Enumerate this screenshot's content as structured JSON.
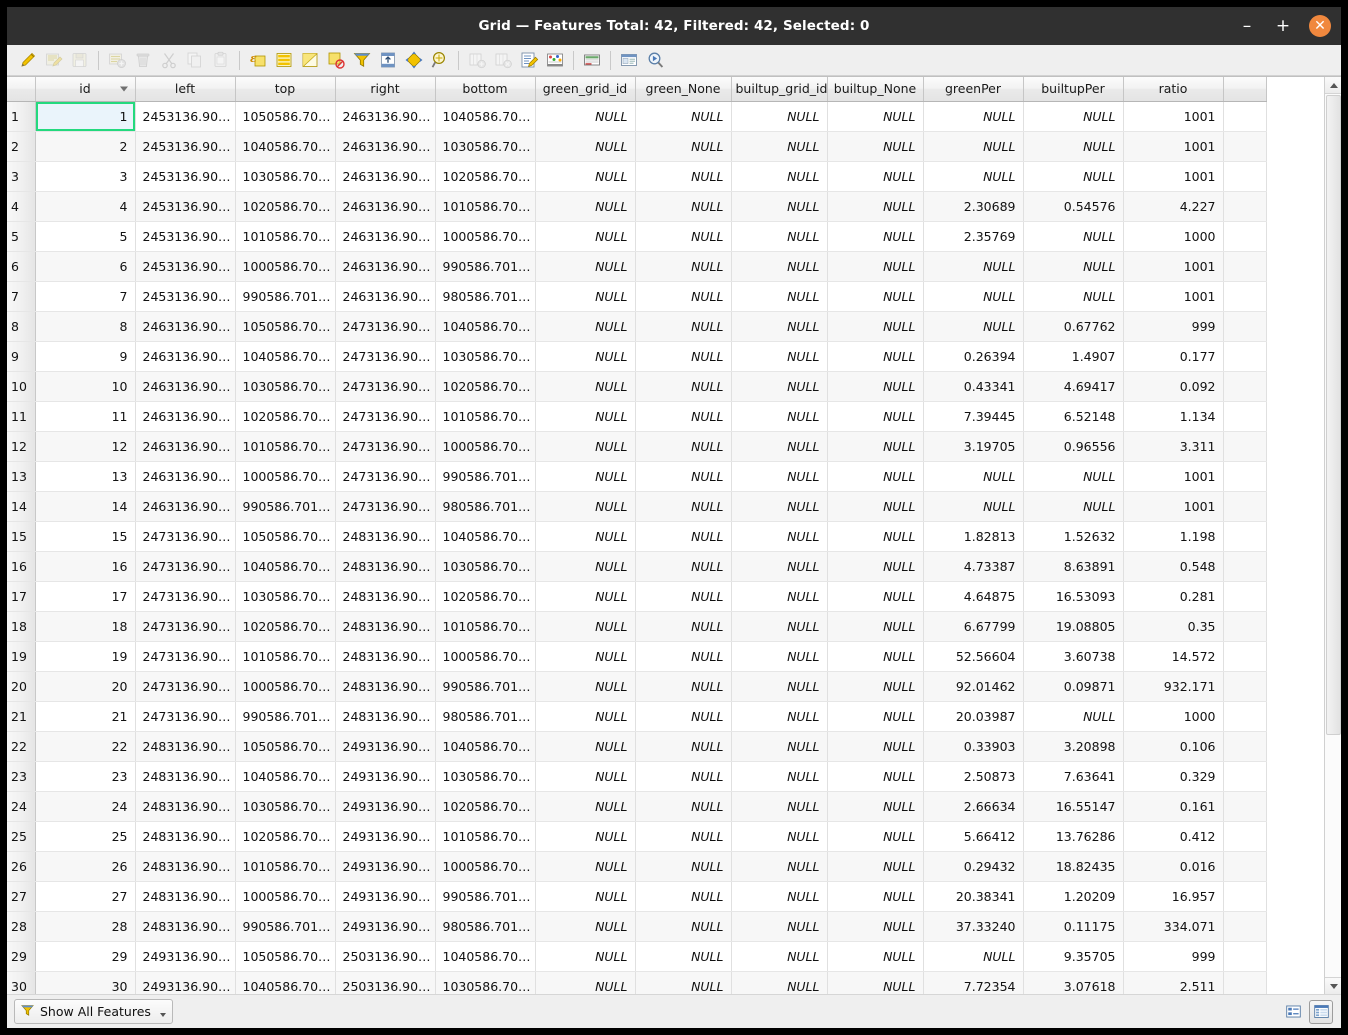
{
  "window": {
    "title": "Grid — Features Total: 42, Filtered: 42, Selected: 0",
    "minimize_label": "–",
    "maximize_label": "+",
    "close_label": "✕"
  },
  "toolbar": {
    "items": [
      {
        "name": "toggle-editing-icon",
        "tip": "Toggle editing mode",
        "enabled": true
      },
      {
        "name": "save-edits-icon",
        "tip": "Save edits",
        "enabled": false
      },
      {
        "name": "reload-table-icon",
        "tip": "Reload the table",
        "enabled": false
      },
      {
        "name": "separator",
        "tip": "",
        "enabled": false
      },
      {
        "name": "add-feature-icon",
        "tip": "Add feature",
        "enabled": false
      },
      {
        "name": "delete-selected-icon",
        "tip": "Delete selected features",
        "enabled": false
      },
      {
        "name": "cut-features-icon",
        "tip": "Cut selected features",
        "enabled": false
      },
      {
        "name": "copy-features-icon",
        "tip": "Copy selected features",
        "enabled": false
      },
      {
        "name": "paste-features-icon",
        "tip": "Paste features",
        "enabled": false
      },
      {
        "name": "separator",
        "tip": "",
        "enabled": false
      },
      {
        "name": "select-by-expression-icon",
        "tip": "Select features using an expression",
        "enabled": true
      },
      {
        "name": "select-all-icon",
        "tip": "Select all features",
        "enabled": true
      },
      {
        "name": "invert-selection-icon",
        "tip": "Invert selection",
        "enabled": true
      },
      {
        "name": "deselect-all-icon",
        "tip": "Deselect all features",
        "enabled": true
      },
      {
        "name": "filter-selection-icon",
        "tip": "Filter / select features",
        "enabled": true
      },
      {
        "name": "move-selection-to-top-icon",
        "tip": "Move selection to top",
        "enabled": true
      },
      {
        "name": "pan-map-to-selection-icon",
        "tip": "Pan map to selected rows",
        "enabled": true
      },
      {
        "name": "zoom-map-to-selection-icon",
        "tip": "Zoom map to selected rows",
        "enabled": true
      },
      {
        "name": "separator",
        "tip": "",
        "enabled": false
      },
      {
        "name": "new-field-icon",
        "tip": "New field",
        "enabled": false
      },
      {
        "name": "delete-field-icon",
        "tip": "Delete field",
        "enabled": false
      },
      {
        "name": "open-field-calculator-icon",
        "tip": "Open field calculator",
        "enabled": true
      },
      {
        "name": "conditional-formatting-icon",
        "tip": "Conditional formatting",
        "enabled": true
      },
      {
        "name": "separator",
        "tip": "",
        "enabled": false
      },
      {
        "name": "organize-columns-icon",
        "tip": "Organize columns",
        "enabled": true
      },
      {
        "name": "separator",
        "tip": "",
        "enabled": false
      },
      {
        "name": "actions-icon",
        "tip": "Actions",
        "enabled": true
      },
      {
        "name": "form-view-search-icon",
        "tip": "Zoom to features",
        "enabled": true
      }
    ]
  },
  "table": {
    "sorted_column": "id",
    "sort_direction": "descending-arrow",
    "selected_cell": {
      "row": 1,
      "column": "id"
    },
    "null_label": "NULL",
    "columns": [
      {
        "key": "id",
        "label": "id"
      },
      {
        "key": "left",
        "label": "left"
      },
      {
        "key": "top",
        "label": "top"
      },
      {
        "key": "right",
        "label": "right"
      },
      {
        "key": "bottom",
        "label": "bottom"
      },
      {
        "key": "green_grid_id",
        "label": "green_grid_id"
      },
      {
        "key": "green_None",
        "label": "green_None"
      },
      {
        "key": "builtup_grid_id",
        "label": "builtup_grid_id"
      },
      {
        "key": "builtup_None",
        "label": "builtup_None"
      },
      {
        "key": "greenPer",
        "label": "greenPer"
      },
      {
        "key": "builtupPer",
        "label": "builtupPer"
      },
      {
        "key": "ratio",
        "label": "ratio"
      }
    ],
    "rows": [
      {
        "n": "1",
        "id": "1",
        "left": "2453136.90…",
        "top": "1050586.70…",
        "right": "2463136.90…",
        "bottom": "1040586.70…",
        "green_grid_id": "NULL",
        "green_None": "NULL",
        "builtup_grid_id": "NULL",
        "builtup_None": "NULL",
        "greenPer": "NULL",
        "builtupPer": "NULL",
        "ratio": "1001"
      },
      {
        "n": "2",
        "id": "2",
        "left": "2453136.90…",
        "top": "1040586.70…",
        "right": "2463136.90…",
        "bottom": "1030586.70…",
        "green_grid_id": "NULL",
        "green_None": "NULL",
        "builtup_grid_id": "NULL",
        "builtup_None": "NULL",
        "greenPer": "NULL",
        "builtupPer": "NULL",
        "ratio": "1001"
      },
      {
        "n": "3",
        "id": "3",
        "left": "2453136.90…",
        "top": "1030586.70…",
        "right": "2463136.90…",
        "bottom": "1020586.70…",
        "green_grid_id": "NULL",
        "green_None": "NULL",
        "builtup_grid_id": "NULL",
        "builtup_None": "NULL",
        "greenPer": "NULL",
        "builtupPer": "NULL",
        "ratio": "1001"
      },
      {
        "n": "4",
        "id": "4",
        "left": "2453136.90…",
        "top": "1020586.70…",
        "right": "2463136.90…",
        "bottom": "1010586.70…",
        "green_grid_id": "NULL",
        "green_None": "NULL",
        "builtup_grid_id": "NULL",
        "builtup_None": "NULL",
        "greenPer": "2.30689",
        "builtupPer": "0.54576",
        "ratio": "4.227"
      },
      {
        "n": "5",
        "id": "5",
        "left": "2453136.90…",
        "top": "1010586.70…",
        "right": "2463136.90…",
        "bottom": "1000586.70…",
        "green_grid_id": "NULL",
        "green_None": "NULL",
        "builtup_grid_id": "NULL",
        "builtup_None": "NULL",
        "greenPer": "2.35769",
        "builtupPer": "NULL",
        "ratio": "1000"
      },
      {
        "n": "6",
        "id": "6",
        "left": "2453136.90…",
        "top": "1000586.70…",
        "right": "2463136.90…",
        "bottom": "990586.701…",
        "green_grid_id": "NULL",
        "green_None": "NULL",
        "builtup_grid_id": "NULL",
        "builtup_None": "NULL",
        "greenPer": "NULL",
        "builtupPer": "NULL",
        "ratio": "1001"
      },
      {
        "n": "7",
        "id": "7",
        "left": "2453136.90…",
        "top": "990586.701…",
        "right": "2463136.90…",
        "bottom": "980586.701…",
        "green_grid_id": "NULL",
        "green_None": "NULL",
        "builtup_grid_id": "NULL",
        "builtup_None": "NULL",
        "greenPer": "NULL",
        "builtupPer": "NULL",
        "ratio": "1001"
      },
      {
        "n": "8",
        "id": "8",
        "left": "2463136.90…",
        "top": "1050586.70…",
        "right": "2473136.90…",
        "bottom": "1040586.70…",
        "green_grid_id": "NULL",
        "green_None": "NULL",
        "builtup_grid_id": "NULL",
        "builtup_None": "NULL",
        "greenPer": "NULL",
        "builtupPer": "0.67762",
        "ratio": "999"
      },
      {
        "n": "9",
        "id": "9",
        "left": "2463136.90…",
        "top": "1040586.70…",
        "right": "2473136.90…",
        "bottom": "1030586.70…",
        "green_grid_id": "NULL",
        "green_None": "NULL",
        "builtup_grid_id": "NULL",
        "builtup_None": "NULL",
        "greenPer": "0.26394",
        "builtupPer": "1.4907",
        "ratio": "0.177"
      },
      {
        "n": "10",
        "id": "10",
        "left": "2463136.90…",
        "top": "1030586.70…",
        "right": "2473136.90…",
        "bottom": "1020586.70…",
        "green_grid_id": "NULL",
        "green_None": "NULL",
        "builtup_grid_id": "NULL",
        "builtup_None": "NULL",
        "greenPer": "0.43341",
        "builtupPer": "4.69417",
        "ratio": "0.092"
      },
      {
        "n": "11",
        "id": "11",
        "left": "2463136.90…",
        "top": "1020586.70…",
        "right": "2473136.90…",
        "bottom": "1010586.70…",
        "green_grid_id": "NULL",
        "green_None": "NULL",
        "builtup_grid_id": "NULL",
        "builtup_None": "NULL",
        "greenPer": "7.39445",
        "builtupPer": "6.52148",
        "ratio": "1.134"
      },
      {
        "n": "12",
        "id": "12",
        "left": "2463136.90…",
        "top": "1010586.70…",
        "right": "2473136.90…",
        "bottom": "1000586.70…",
        "green_grid_id": "NULL",
        "green_None": "NULL",
        "builtup_grid_id": "NULL",
        "builtup_None": "NULL",
        "greenPer": "3.19705",
        "builtupPer": "0.96556",
        "ratio": "3.311"
      },
      {
        "n": "13",
        "id": "13",
        "left": "2463136.90…",
        "top": "1000586.70…",
        "right": "2473136.90…",
        "bottom": "990586.701…",
        "green_grid_id": "NULL",
        "green_None": "NULL",
        "builtup_grid_id": "NULL",
        "builtup_None": "NULL",
        "greenPer": "NULL",
        "builtupPer": "NULL",
        "ratio": "1001"
      },
      {
        "n": "14",
        "id": "14",
        "left": "2463136.90…",
        "top": "990586.701…",
        "right": "2473136.90…",
        "bottom": "980586.701…",
        "green_grid_id": "NULL",
        "green_None": "NULL",
        "builtup_grid_id": "NULL",
        "builtup_None": "NULL",
        "greenPer": "NULL",
        "builtupPer": "NULL",
        "ratio": "1001"
      },
      {
        "n": "15",
        "id": "15",
        "left": "2473136.90…",
        "top": "1050586.70…",
        "right": "2483136.90…",
        "bottom": "1040586.70…",
        "green_grid_id": "NULL",
        "green_None": "NULL",
        "builtup_grid_id": "NULL",
        "builtup_None": "NULL",
        "greenPer": "1.82813",
        "builtupPer": "1.52632",
        "ratio": "1.198"
      },
      {
        "n": "16",
        "id": "16",
        "left": "2473136.90…",
        "top": "1040586.70…",
        "right": "2483136.90…",
        "bottom": "1030586.70…",
        "green_grid_id": "NULL",
        "green_None": "NULL",
        "builtup_grid_id": "NULL",
        "builtup_None": "NULL",
        "greenPer": "4.73387",
        "builtupPer": "8.63891",
        "ratio": "0.548"
      },
      {
        "n": "17",
        "id": "17",
        "left": "2473136.90…",
        "top": "1030586.70…",
        "right": "2483136.90…",
        "bottom": "1020586.70…",
        "green_grid_id": "NULL",
        "green_None": "NULL",
        "builtup_grid_id": "NULL",
        "builtup_None": "NULL",
        "greenPer": "4.64875",
        "builtupPer": "16.53093",
        "ratio": "0.281"
      },
      {
        "n": "18",
        "id": "18",
        "left": "2473136.90…",
        "top": "1020586.70…",
        "right": "2483136.90…",
        "bottom": "1010586.70…",
        "green_grid_id": "NULL",
        "green_None": "NULL",
        "builtup_grid_id": "NULL",
        "builtup_None": "NULL",
        "greenPer": "6.67799",
        "builtupPer": "19.08805",
        "ratio": "0.35"
      },
      {
        "n": "19",
        "id": "19",
        "left": "2473136.90…",
        "top": "1010586.70…",
        "right": "2483136.90…",
        "bottom": "1000586.70…",
        "green_grid_id": "NULL",
        "green_None": "NULL",
        "builtup_grid_id": "NULL",
        "builtup_None": "NULL",
        "greenPer": "52.56604",
        "builtupPer": "3.60738",
        "ratio": "14.572"
      },
      {
        "n": "20",
        "id": "20",
        "left": "2473136.90…",
        "top": "1000586.70…",
        "right": "2483136.90…",
        "bottom": "990586.701…",
        "green_grid_id": "NULL",
        "green_None": "NULL",
        "builtup_grid_id": "NULL",
        "builtup_None": "NULL",
        "greenPer": "92.01462",
        "builtupPer": "0.09871",
        "ratio": "932.171"
      },
      {
        "n": "21",
        "id": "21",
        "left": "2473136.90…",
        "top": "990586.701…",
        "right": "2483136.90…",
        "bottom": "980586.701…",
        "green_grid_id": "NULL",
        "green_None": "NULL",
        "builtup_grid_id": "NULL",
        "builtup_None": "NULL",
        "greenPer": "20.03987",
        "builtupPer": "NULL",
        "ratio": "1000"
      },
      {
        "n": "22",
        "id": "22",
        "left": "2483136.90…",
        "top": "1050586.70…",
        "right": "2493136.90…",
        "bottom": "1040586.70…",
        "green_grid_id": "NULL",
        "green_None": "NULL",
        "builtup_grid_id": "NULL",
        "builtup_None": "NULL",
        "greenPer": "0.33903",
        "builtupPer": "3.20898",
        "ratio": "0.106"
      },
      {
        "n": "23",
        "id": "23",
        "left": "2483136.90…",
        "top": "1040586.70…",
        "right": "2493136.90…",
        "bottom": "1030586.70…",
        "green_grid_id": "NULL",
        "green_None": "NULL",
        "builtup_grid_id": "NULL",
        "builtup_None": "NULL",
        "greenPer": "2.50873",
        "builtupPer": "7.63641",
        "ratio": "0.329"
      },
      {
        "n": "24",
        "id": "24",
        "left": "2483136.90…",
        "top": "1030586.70…",
        "right": "2493136.90…",
        "bottom": "1020586.70…",
        "green_grid_id": "NULL",
        "green_None": "NULL",
        "builtup_grid_id": "NULL",
        "builtup_None": "NULL",
        "greenPer": "2.66634",
        "builtupPer": "16.55147",
        "ratio": "0.161"
      },
      {
        "n": "25",
        "id": "25",
        "left": "2483136.90…",
        "top": "1020586.70…",
        "right": "2493136.90…",
        "bottom": "1010586.70…",
        "green_grid_id": "NULL",
        "green_None": "NULL",
        "builtup_grid_id": "NULL",
        "builtup_None": "NULL",
        "greenPer": "5.66412",
        "builtupPer": "13.76286",
        "ratio": "0.412"
      },
      {
        "n": "26",
        "id": "26",
        "left": "2483136.90…",
        "top": "1010586.70…",
        "right": "2493136.90…",
        "bottom": "1000586.70…",
        "green_grid_id": "NULL",
        "green_None": "NULL",
        "builtup_grid_id": "NULL",
        "builtup_None": "NULL",
        "greenPer": "0.29432",
        "builtupPer": "18.82435",
        "ratio": "0.016"
      },
      {
        "n": "27",
        "id": "27",
        "left": "2483136.90…",
        "top": "1000586.70…",
        "right": "2493136.90…",
        "bottom": "990586.701…",
        "green_grid_id": "NULL",
        "green_None": "NULL",
        "builtup_grid_id": "NULL",
        "builtup_None": "NULL",
        "greenPer": "20.38341",
        "builtupPer": "1.20209",
        "ratio": "16.957"
      },
      {
        "n": "28",
        "id": "28",
        "left": "2483136.90…",
        "top": "990586.701…",
        "right": "2493136.90…",
        "bottom": "980586.701…",
        "green_grid_id": "NULL",
        "green_None": "NULL",
        "builtup_grid_id": "NULL",
        "builtup_None": "NULL",
        "greenPer": "37.33240",
        "builtupPer": "0.11175",
        "ratio": "334.071"
      },
      {
        "n": "29",
        "id": "29",
        "left": "2493136.90…",
        "top": "1050586.70…",
        "right": "2503136.90…",
        "bottom": "1040586.70…",
        "green_grid_id": "NULL",
        "green_None": "NULL",
        "builtup_grid_id": "NULL",
        "builtup_None": "NULL",
        "greenPer": "NULL",
        "builtupPer": "9.35705",
        "ratio": "999"
      },
      {
        "n": "30",
        "id": "30",
        "left": "2493136.90…",
        "top": "1040586.70…",
        "right": "2503136.90…",
        "bottom": "1030586.70…",
        "green_grid_id": "NULL",
        "green_None": "NULL",
        "builtup_grid_id": "NULL",
        "builtup_None": "NULL",
        "greenPer": "7.72354",
        "builtupPer": "3.07618",
        "ratio": "2.511"
      }
    ]
  },
  "statusbar": {
    "filter_label": "Show All Features",
    "view_form_name": "form-view-button",
    "view_table_name": "table-view-button"
  },
  "colors": {
    "titlebar_bg": "#303030",
    "close_button": "#f0883e",
    "selection_border": "#24d97e",
    "selection_fill": "#eaf4fb",
    "null_text": "#9a9a9a",
    "accent_yellow": "#f2c200",
    "accent_blue": "#4a79b8"
  }
}
